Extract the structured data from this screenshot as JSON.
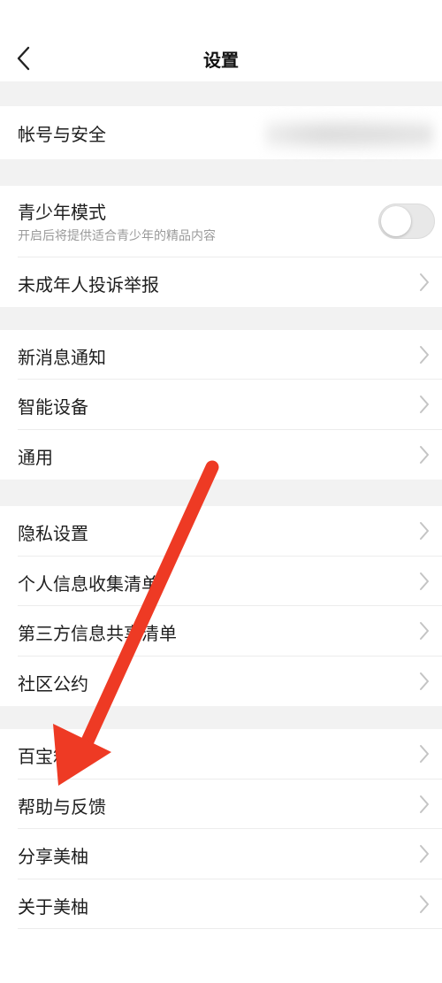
{
  "header": {
    "title": "设置",
    "back_icon": "chevron-left-icon"
  },
  "account": {
    "label": "帐号与安全"
  },
  "teen": {
    "title": "青少年模式",
    "desc": "开启后将提供适合青少年的精品内容",
    "toggle_on": false
  },
  "minor_report": {
    "label": "未成年人投诉举报"
  },
  "group2": [
    "新消息通知",
    "智能设备",
    "通用"
  ],
  "group3": [
    "隐私设置",
    "个人信息收集清单",
    "第三方信息共享清单",
    "社区公约"
  ],
  "group4": [
    "百宝箱",
    "帮助与反馈",
    "分享美柚",
    "关于美柚"
  ],
  "colors": {
    "annotation_arrow": "#ee3a24",
    "section_gap": "#f2f2f2",
    "chevron": "#c4c4c4"
  }
}
